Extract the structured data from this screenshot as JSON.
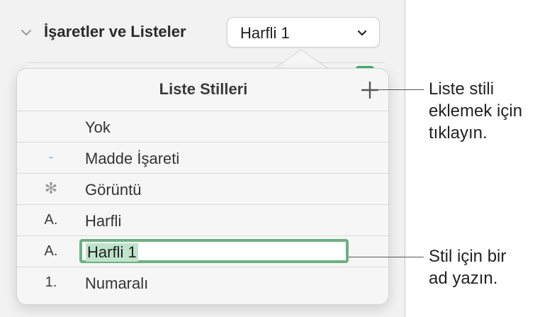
{
  "section": {
    "title": "İşaretler ve Listeler",
    "dropdown_value": "Harfli 1",
    "icons": {
      "collapse": "chevron-down-icon",
      "dropdown": "chevron-down-icon"
    }
  },
  "popover": {
    "title": "Liste Stilleri",
    "add_icon": "plus-icon",
    "items": [
      {
        "marker": "",
        "label": "Yok"
      },
      {
        "marker": "-",
        "label": "Madde İşareti"
      },
      {
        "marker": "✻",
        "label": "Görüntü"
      },
      {
        "marker": "A.",
        "label": "Harfli"
      },
      {
        "marker": "A.",
        "label": "Harfli 1",
        "editing": true
      },
      {
        "marker": "1.",
        "label": "Numaralı"
      }
    ]
  },
  "callouts": {
    "add_style": [
      "Liste stili",
      "eklemek için",
      "tıklayın."
    ],
    "type_name": [
      "Stil için bir",
      "ad yazın."
    ]
  },
  "colors": {
    "edit_border": "#6cb083",
    "selection": "#bfe3cb",
    "bullet": "#4aa8e8"
  }
}
